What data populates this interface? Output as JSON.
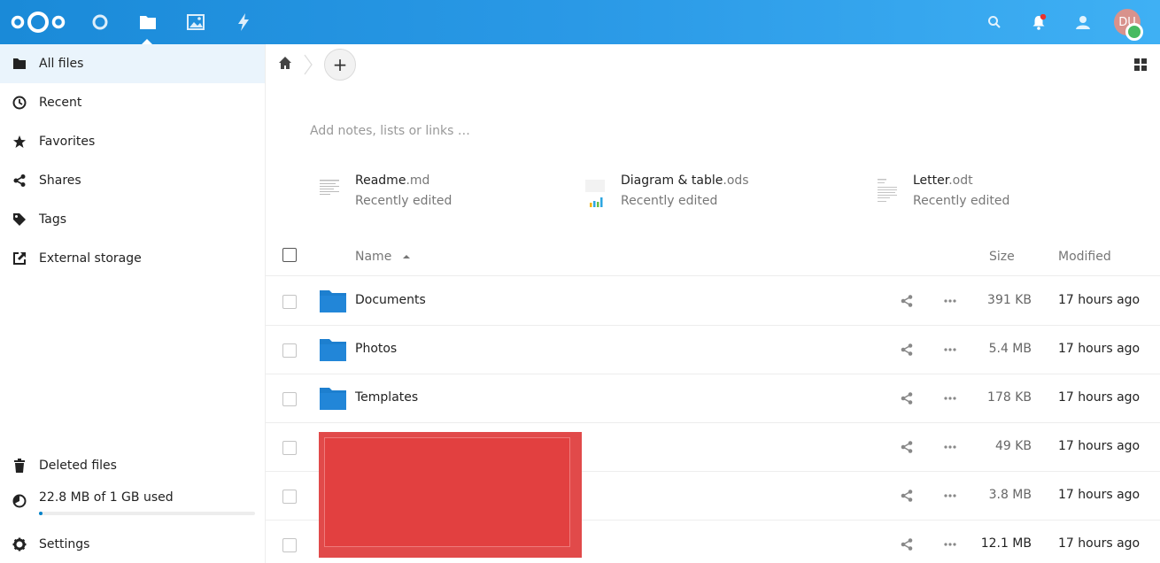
{
  "header": {
    "apps": [
      "dashboard-icon",
      "files-icon",
      "photos-icon",
      "activity-icon"
    ],
    "active_app": "files-icon",
    "right_icons": [
      "search-icon",
      "notifications-icon",
      "contacts-icon"
    ],
    "avatar_initials": "DU",
    "accent": "#0082c9"
  },
  "sidebar": {
    "items": [
      {
        "label": "All files",
        "icon": "folder-icon",
        "active": true
      },
      {
        "label": "Recent",
        "icon": "clock-icon"
      },
      {
        "label": "Favorites",
        "icon": "star-icon"
      },
      {
        "label": "Shares",
        "icon": "share-icon"
      },
      {
        "label": "Tags",
        "icon": "tag-icon"
      },
      {
        "label": "External storage",
        "icon": "external-link-icon"
      }
    ],
    "bottom": {
      "deleted": "Deleted files",
      "quota": "22.8 MB of 1 GB used",
      "quota_fraction": 0.0228,
      "settings": "Settings"
    }
  },
  "main": {
    "add_button": "+",
    "notes_placeholder": "Add notes, lists or links …",
    "recent": [
      {
        "name": "Readme",
        "ext": ".md",
        "sub": "Recently edited"
      },
      {
        "name": "Diagram & table",
        "ext": ".ods",
        "sub": "Recently edited"
      },
      {
        "name": "Letter",
        "ext": ".odt",
        "sub": "Recently edited"
      }
    ],
    "columns": {
      "name": "Name",
      "size": "Size",
      "modified": "Modified"
    },
    "files": [
      {
        "name": "Documents",
        "size": "391 KB",
        "modified": "17 hours ago"
      },
      {
        "name": "Photos",
        "size": "5.4 MB",
        "modified": "17 hours ago"
      },
      {
        "name": "Templates",
        "size": "178 KB",
        "modified": "17 hours ago"
      },
      {
        "name": "",
        "size": "49 KB",
        "modified": "17 hours ago"
      },
      {
        "name": "",
        "size": "3.8 MB",
        "modified": "17 hours ago"
      },
      {
        "name": "",
        "size": "12.1 MB",
        "modified": "17 hours ago"
      }
    ]
  }
}
